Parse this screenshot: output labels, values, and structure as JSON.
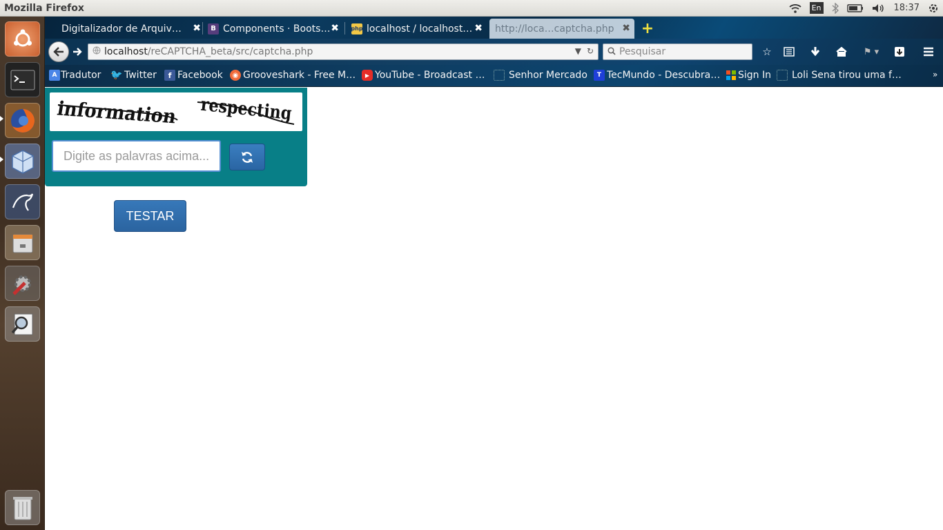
{
  "window": {
    "title": "Mozilla Firefox"
  },
  "tray": {
    "keyboard_layout": "En",
    "clock": "18:37",
    "icons": [
      "wifi-icon",
      "bluetooth-icon",
      "battery-icon",
      "volume-icon",
      "power-icon"
    ]
  },
  "launcher": {
    "items": [
      "ubuntu-dash-icon",
      "terminal-icon",
      "firefox-icon",
      "virtualbox-icon",
      "mysql-workbench-icon",
      "file-manager-icon",
      "system-settings-icon",
      "search-tool-icon",
      "trash-icon"
    ]
  },
  "tabs": [
    {
      "title": "Digitalizador de Arquiv…",
      "icon": "none"
    },
    {
      "title": "Components · Boots…",
      "icon": "bootstrap-icon"
    },
    {
      "title": "localhost / localhost…",
      "icon": "phpmyadmin-icon"
    },
    {
      "title": "http://loca…captcha.php",
      "icon": "none",
      "active": true
    }
  ],
  "nav": {
    "url_host": "localhost",
    "url_path": "/reCAPTCHA_beta/src/captcha.php",
    "search_placeholder": "Pesquisar"
  },
  "bookmarks": [
    {
      "label": "Tradutor",
      "icon": "translate-icon"
    },
    {
      "label": "Twitter",
      "icon": "twitter-icon"
    },
    {
      "label": "Facebook",
      "icon": "facebook-icon"
    },
    {
      "label": "Grooveshark - Free M…",
      "icon": "grooveshark-icon"
    },
    {
      "label": "YouTube - Broadcast …",
      "icon": "youtube-icon"
    },
    {
      "label": "Senhor Mercado",
      "icon": "page-icon"
    },
    {
      "label": "TecMundo - Descubra…",
      "icon": "tecmundo-icon"
    },
    {
      "label": "Sign In",
      "icon": "microsoft-icon"
    },
    {
      "label": "Loli Sena tirou uma f…",
      "icon": "page-icon"
    }
  ],
  "captcha": {
    "words": [
      "information",
      "respecting"
    ],
    "input_placeholder": "Digite as palavras acima...",
    "refresh_icon": "refresh-icon"
  },
  "actions": {
    "test_label": "TESTAR"
  },
  "colors": {
    "captcha_panel": "#087f87",
    "button": "#2b64a0"
  }
}
